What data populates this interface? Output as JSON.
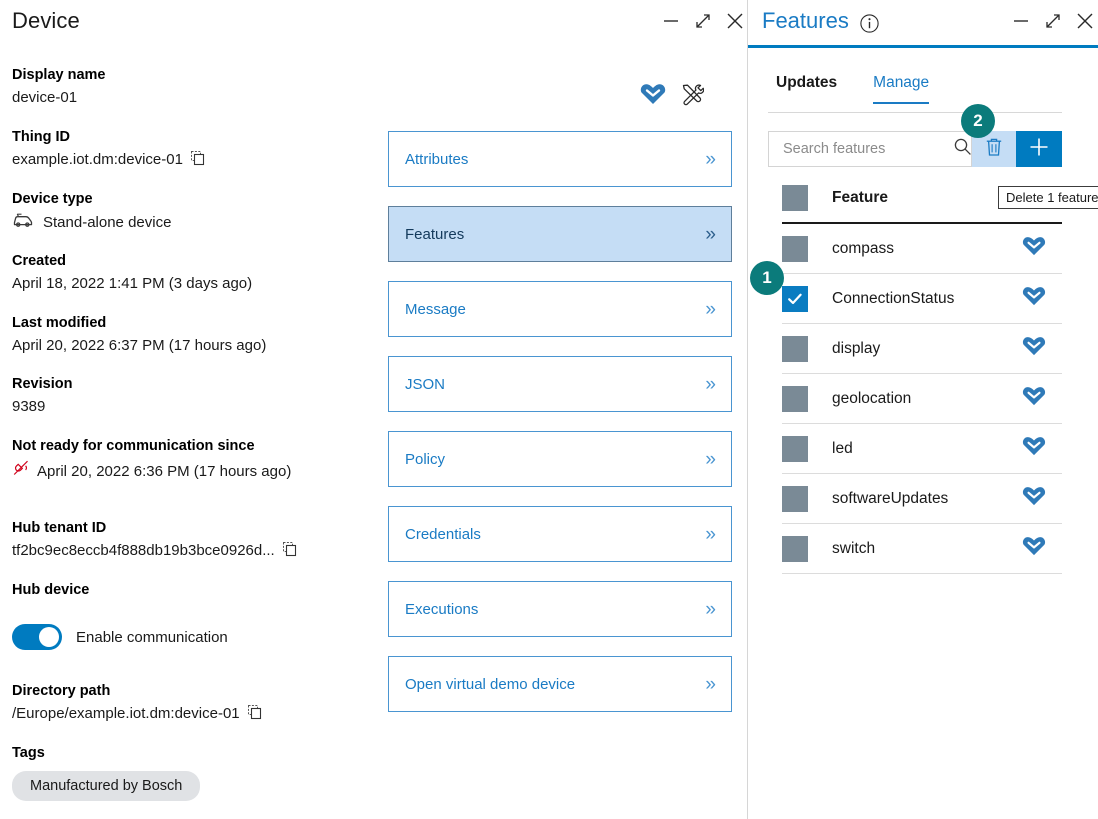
{
  "device": {
    "title": "Device",
    "window_controls": [
      "minimize-icon",
      "expand-icon",
      "close-icon"
    ],
    "fields": [
      {
        "label": "Display name",
        "value": "device-01",
        "copy": false
      },
      {
        "label": "Thing ID",
        "value": "example.iot.dm:device-01",
        "copy": true
      },
      {
        "label": "Device type",
        "value": "Stand-alone device",
        "copy": false
      },
      {
        "label": "Created",
        "value": "April 18, 2022 1:41 PM (3 days ago)",
        "copy": false
      },
      {
        "label": "Last modified",
        "value": "April 20, 2022 6:37 PM (17 hours ago)",
        "copy": false
      },
      {
        "label": "Revision",
        "value": "9389",
        "copy": false
      },
      {
        "label": "Not ready for communication since",
        "value": "April 20, 2022 6:36 PM (17 hours ago)",
        "copy": false
      },
      {
        "label": "Hub tenant ID",
        "value": "tf2bc9ec8eccb4f888db19b3bce0926d...",
        "copy": true
      },
      {
        "label": "Hub device",
        "value": "",
        "copy": false
      },
      {
        "label": "Directory path",
        "value": "/Europe/example.iot.dm:device-01",
        "copy": true
      },
      {
        "label": "Tags",
        "value": "",
        "copy": false
      }
    ],
    "toggle_label": "Enable communication",
    "toggle_on": true,
    "tag": "Manufactured by Bosch",
    "header_icons": [
      "bosch-iot-logo-icon",
      "tools-icon"
    ]
  },
  "nav": {
    "buttons": [
      {
        "label": "Attributes",
        "selected": false
      },
      {
        "label": "Features",
        "selected": true
      },
      {
        "label": "Message",
        "selected": false
      },
      {
        "label": "JSON",
        "selected": false
      },
      {
        "label": "Policy",
        "selected": false
      },
      {
        "label": "Credentials",
        "selected": false
      },
      {
        "label": "Executions",
        "selected": false
      },
      {
        "label": "Open virtual demo device",
        "selected": false
      }
    ],
    "chevron": "»"
  },
  "features": {
    "title": "Features",
    "window_controls": [
      "minimize-icon",
      "expand-icon",
      "close-icon"
    ],
    "tabs": [
      {
        "label": "Updates",
        "active": false
      },
      {
        "label": "Manage",
        "active": true
      }
    ],
    "search": {
      "placeholder": "Search features",
      "value": ""
    },
    "delete_button_label": "delete-icon",
    "add_button_label": "+",
    "tooltip": "Delete 1 feature",
    "column_header": "Feature",
    "rows": [
      {
        "name": "compass",
        "checked": false
      },
      {
        "name": "ConnectionStatus",
        "checked": true
      },
      {
        "name": "display",
        "checked": false
      },
      {
        "name": "geolocation",
        "checked": false
      },
      {
        "name": "led",
        "checked": false
      },
      {
        "name": "softwareUpdates",
        "checked": false
      },
      {
        "name": "switch",
        "checked": false
      }
    ]
  },
  "badges": [
    {
      "number": "1"
    },
    {
      "number": "2"
    }
  ],
  "colors": {
    "accent_blue": "#007bc0",
    "link_blue": "#1a7bc4",
    "selected_fill": "#c5ddf5",
    "badge_teal": "#0b7b7b",
    "checkbox_gray": "#7a8a96"
  }
}
